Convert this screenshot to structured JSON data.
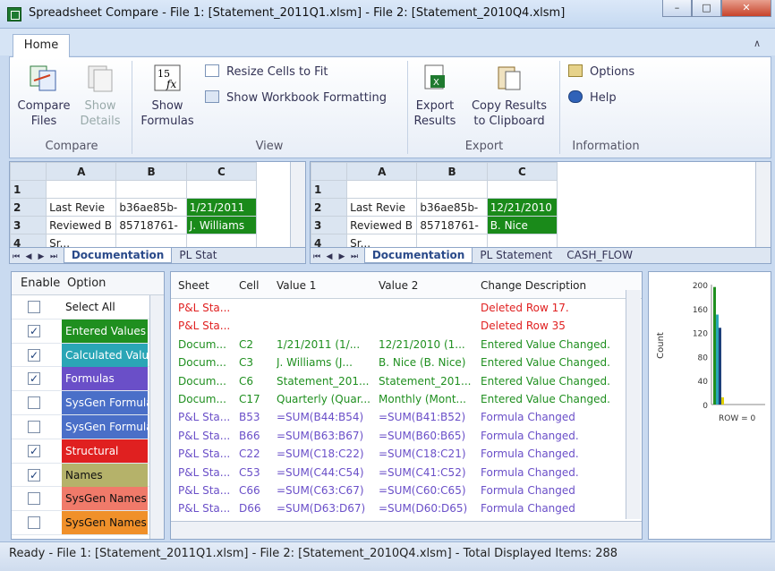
{
  "window": {
    "title": "Spreadsheet Compare - File 1: [Statement_2011Q1.xlsm] - File 2: [Statement_2010Q4.xlsm]",
    "minimize": "–",
    "maximize": "□",
    "close": "✕"
  },
  "ribbon": {
    "tab": "Home",
    "compare_files": [
      "Compare",
      "Files"
    ],
    "show_details": [
      "Show",
      "Details"
    ],
    "show_formulas": [
      "Show",
      "Formulas"
    ],
    "resize_cells": "Resize Cells to Fit",
    "show_wb_format": "Show Workbook Formatting",
    "export_results": [
      "Export",
      "Results"
    ],
    "copy_results": [
      "Copy Results",
      "to Clipboard"
    ],
    "options": "Options",
    "help": "Help",
    "groups": {
      "compare": "Compare",
      "view": "View",
      "export": "Export",
      "information": "Information"
    }
  },
  "grid_left": {
    "cols": [
      "A",
      "B",
      "C"
    ],
    "rows": [
      {
        "n": "1",
        "a": "",
        "b": "",
        "c": ""
      },
      {
        "n": "2",
        "a": "Last Revie",
        "b": "b36ae85b-",
        "c": "1/21/2011"
      },
      {
        "n": "3",
        "a": "Reviewed B",
        "b": "85718761-",
        "c": "J. Williams"
      },
      {
        "n": "4",
        "a": "Sr...",
        "b": "",
        "c": ""
      }
    ],
    "tabs": [
      "Documentation",
      "PL Stat"
    ]
  },
  "grid_right": {
    "cols": [
      "A",
      "B",
      "C"
    ],
    "rows": [
      {
        "n": "1",
        "a": "",
        "b": "",
        "c": ""
      },
      {
        "n": "2",
        "a": "Last Revie",
        "b": "b36ae85b-",
        "c": "12/21/2010"
      },
      {
        "n": "3",
        "a": "Reviewed B",
        "b": "85718761-",
        "c": "B. Nice"
      },
      {
        "n": "4",
        "a": "Sr...",
        "b": "",
        "c": ""
      }
    ],
    "tabs": [
      "Documentation",
      "PL Statement",
      "CASH_FLOW"
    ]
  },
  "options": {
    "header_enable": "Enable",
    "header_option": "Option",
    "items": [
      {
        "label": "Select All",
        "checked": false,
        "color": "#ffffff",
        "text": "#111111"
      },
      {
        "label": "Entered Values",
        "checked": true,
        "color": "#1f8f1f",
        "text": "#ffffff"
      },
      {
        "label": "Calculated Values",
        "checked": true,
        "color": "#2aa6b6",
        "text": "#ffffff"
      },
      {
        "label": "Formulas",
        "checked": true,
        "color": "#6a4fc8",
        "text": "#ffffff"
      },
      {
        "label": "SysGen Formulas",
        "checked": false,
        "color": "#4a6fc8",
        "text": "#ffffff"
      },
      {
        "label": "SysGen Formulas",
        "checked": false,
        "color": "#4a6fc8",
        "text": "#ffffff"
      },
      {
        "label": "Structural",
        "checked": true,
        "color": "#e02020",
        "text": "#ffffff"
      },
      {
        "label": "Names",
        "checked": true,
        "color": "#b5b26a",
        "text": "#111111"
      },
      {
        "label": "SysGen Names",
        "checked": false,
        "color": "#f07a6a",
        "text": "#111111"
      },
      {
        "label": "SysGen Names",
        "checked": false,
        "color": "#f0902a",
        "text": "#111111"
      }
    ]
  },
  "results": {
    "headers": [
      "Sheet",
      "Cell",
      "Value 1",
      "Value 2",
      "Change Description"
    ],
    "rows": [
      {
        "sheet": "P&L Sta...",
        "cell": "",
        "v1": "",
        "v2": "",
        "desc": "Deleted Row 17.",
        "color": "#e02020"
      },
      {
        "sheet": "P&L Sta...",
        "cell": "",
        "v1": "",
        "v2": "",
        "desc": "Deleted Row 35",
        "color": "#e02020"
      },
      {
        "sheet": "Docum...",
        "cell": "C2",
        "v1": "1/21/2011 (1/...",
        "v2": "12/21/2010 (1...",
        "desc": "Entered Value Changed.",
        "color": "#1f8f1f"
      },
      {
        "sheet": "Docum...",
        "cell": "C3",
        "v1": "J. Williams (J...",
        "v2": "B. Nice (B. Nice)",
        "desc": "Entered Value Changed.",
        "color": "#1f8f1f"
      },
      {
        "sheet": "Docum...",
        "cell": "C6",
        "v1": "Statement_201...",
        "v2": "Statement_201...",
        "desc": "Entered Value Changed.",
        "color": "#1f8f1f"
      },
      {
        "sheet": "Docum...",
        "cell": "C17",
        "v1": "Quarterly (Quar...",
        "v2": "Monthly (Mont...",
        "desc": "Entered Value Changed.",
        "color": "#1f8f1f"
      },
      {
        "sheet": "P&L Sta...",
        "cell": "B53",
        "v1": "=SUM(B44:B54)",
        "v2": "=SUM(B41:B52)",
        "desc": "Formula Changed",
        "color": "#6a4fc8"
      },
      {
        "sheet": "P&L Sta...",
        "cell": "B66",
        "v1": "=SUM(B63:B67)",
        "v2": "=SUM(B60:B65)",
        "desc": "Formula Changed.",
        "color": "#6a4fc8"
      },
      {
        "sheet": "P&L Sta...",
        "cell": "C22",
        "v1": "=SUM(C18:C22)",
        "v2": "=SUM(C18:C21)",
        "desc": "Formula Changed.",
        "color": "#6a4fc8"
      },
      {
        "sheet": "P&L Sta...",
        "cell": "C53",
        "v1": "=SUM(C44:C54)",
        "v2": "=SUM(C41:C52)",
        "desc": "Formula Changed.",
        "color": "#6a4fc8"
      },
      {
        "sheet": "P&L Sta...",
        "cell": "C66",
        "v1": "=SUM(C63:C67)",
        "v2": "=SUM(C60:C65)",
        "desc": "Formula Changed",
        "color": "#6a4fc8"
      },
      {
        "sheet": "P&L Sta...",
        "cell": "D66",
        "v1": "=SUM(D63:D67)",
        "v2": "=SUM(D60:D65)",
        "desc": "Formula Changed",
        "color": "#6a4fc8"
      }
    ]
  },
  "chart_data": {
    "type": "bar",
    "ylabel": "Count",
    "ylim": [
      0,
      200
    ],
    "yticks": [
      "200",
      "160",
      "120",
      "80",
      "40",
      "0"
    ],
    "xlabel": "ROW = 0",
    "series": [
      {
        "color": "#1f8f1f",
        "value": 196
      },
      {
        "color": "#2aa6b6",
        "value": 150
      },
      {
        "color": "#1d3f7a",
        "value": 128
      },
      {
        "color": "#e0d000",
        "value": 12
      }
    ]
  },
  "status": "Ready - File 1: [Statement_2011Q1.xlsm] - File 2: [Statement_2010Q4.xlsm] - Total Displayed Items: 288"
}
